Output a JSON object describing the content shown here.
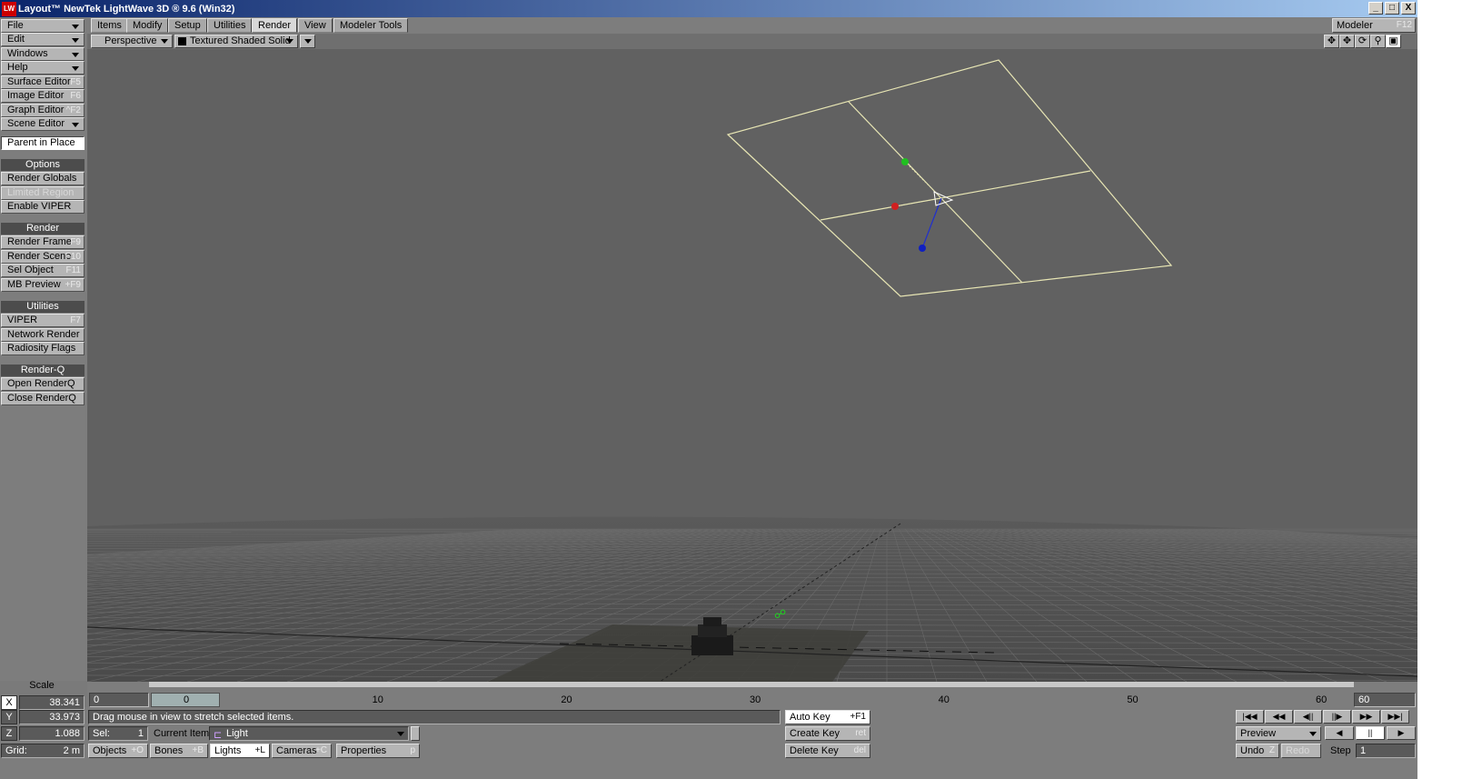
{
  "window": {
    "title": "Layout™ NewTek LightWave 3D ® 9.6  (Win32)",
    "app_icon": "lightwave-logo-icon",
    "controls": [
      "_",
      "□",
      "X"
    ]
  },
  "left_panel": {
    "menus": [
      {
        "label": "File"
      },
      {
        "label": "Edit"
      },
      {
        "label": "Windows"
      },
      {
        "label": "Help"
      }
    ],
    "editors": [
      {
        "label": "Surface Editor",
        "shortcut": "F5"
      },
      {
        "label": "Image Editor",
        "shortcut": "F6"
      },
      {
        "label": "Graph Editor",
        "shortcut": "^F2"
      },
      {
        "label": "Scene Editor",
        "shortcut": ""
      }
    ],
    "parent_in_place": "Parent in Place",
    "options": {
      "heading": "Options",
      "items": [
        {
          "label": "Render Globals",
          "shortcut": ""
        },
        {
          "label": "Limited Region",
          "shortcut": ""
        },
        {
          "label": "Enable VIPER",
          "shortcut": ""
        }
      ]
    },
    "render": {
      "heading": "Render",
      "items": [
        {
          "label": "Render Frame",
          "shortcut": "F9"
        },
        {
          "label": "Render Scene",
          "shortcut": "F10"
        },
        {
          "label": "Sel Object",
          "shortcut": "F11"
        },
        {
          "label": "MB Preview",
          "shortcut": "+F9"
        }
      ]
    },
    "utilities": {
      "heading": "Utilities",
      "items": [
        {
          "label": "VIPER",
          "shortcut": "F7"
        },
        {
          "label": "Network Render",
          "shortcut": ""
        },
        {
          "label": "Radiosity Flags",
          "shortcut": ""
        }
      ]
    },
    "renderq": {
      "heading": "Render-Q",
      "items": [
        {
          "label": "Open RenderQ",
          "shortcut": ""
        },
        {
          "label": "Close RenderQ",
          "shortcut": ""
        }
      ]
    }
  },
  "tabs": [
    {
      "label": "Items"
    },
    {
      "label": "Modify"
    },
    {
      "label": "Setup"
    },
    {
      "label": "Utilities"
    },
    {
      "label": "Render"
    },
    {
      "label": "View"
    },
    {
      "label": "Modeler Tools"
    }
  ],
  "active_tab": "Render",
  "modeler": {
    "label": "Modeler",
    "shortcut": "F12"
  },
  "viewport_header": {
    "view_mode": "Perspective",
    "render_mode": "Textured Shaded Solid",
    "nav_icons": [
      "move-view-icon",
      "move-view-icon",
      "rotate-view-icon",
      "zoom-view-icon",
      "maximize-view-icon"
    ]
  },
  "timeline": {
    "start": "0",
    "current": "0",
    "end": "60",
    "ticks": [
      "0",
      "10",
      "20",
      "30",
      "40",
      "50",
      "60"
    ],
    "scale_label": "Scale"
  },
  "coords": {
    "x_label": "X",
    "x": "38.341",
    "y_label": "Y",
    "y": "33.973",
    "z_label": "Z",
    "z": "1.088",
    "grid_label": "Grid:",
    "grid": "2 m"
  },
  "status": {
    "message": "Drag mouse in view to stretch selected items.",
    "sel_label": "Sel:",
    "sel_count": "1",
    "current_item_label": "Current Item",
    "current_item": "Light"
  },
  "item_types": [
    {
      "label": "Objects",
      "shortcut": "+O"
    },
    {
      "label": "Bones",
      "shortcut": "+B"
    },
    {
      "label": "Lights",
      "shortcut": "+L"
    },
    {
      "label": "Cameras",
      "shortcut": "+C"
    },
    {
      "label": "Properties",
      "shortcut": "p"
    }
  ],
  "keys": [
    {
      "label": "Auto Key",
      "shortcut": "+F1"
    },
    {
      "label": "Create Key",
      "shortcut": "ret"
    },
    {
      "label": "Delete Key",
      "shortcut": "del"
    }
  ],
  "playback": {
    "transport_icons": [
      "first-frame-icon",
      "prev-key-icon",
      "prev-frame-icon",
      "next-frame-icon",
      "next-key-icon",
      "last-frame-icon"
    ],
    "preview": "Preview",
    "play_controls": [
      "play-reverse-icon",
      "pause-icon",
      "play-forward-icon"
    ],
    "undo": "Undo",
    "undo_shortcut": "Z",
    "redo": "Redo",
    "step_label": "Step",
    "step": "1"
  }
}
